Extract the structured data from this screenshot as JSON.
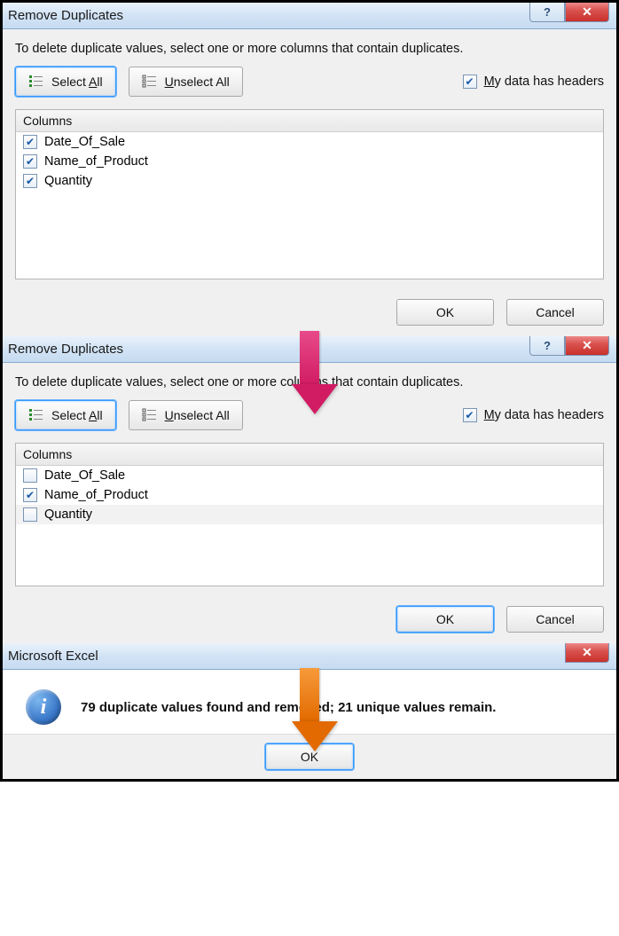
{
  "dialog1": {
    "title": "Remove Duplicates",
    "help_tip": "?",
    "close_tip": "✕",
    "instruction": "To delete duplicate values, select one or more columns that contain duplicates.",
    "select_all": {
      "prefix": "Select ",
      "hot": "A",
      "suffix": "ll"
    },
    "unselect_all": {
      "prefix": "",
      "hot": "U",
      "suffix": "nselect All"
    },
    "headers_chk": {
      "checked": true,
      "prefix": "",
      "hot": "M",
      "suffix": "y data has headers"
    },
    "columns_header": "Columns",
    "columns": [
      {
        "label": "Date_Of_Sale",
        "checked": true
      },
      {
        "label": "Name_of_Product",
        "checked": true
      },
      {
        "label": "Quantity",
        "checked": true
      }
    ],
    "ok": "OK",
    "cancel": "Cancel"
  },
  "dialog2": {
    "title": "Remove Duplicates",
    "help_tip": "?",
    "close_tip": "✕",
    "instruction": "To delete duplicate values, select one or more columns that contain duplicates.",
    "select_all": {
      "prefix": "Select ",
      "hot": "A",
      "suffix": "ll"
    },
    "unselect_all": {
      "prefix": "",
      "hot": "U",
      "suffix": "nselect All"
    },
    "headers_chk": {
      "checked": true,
      "prefix": "",
      "hot": "M",
      "suffix": "y data has headers"
    },
    "columns_header": "Columns",
    "columns": [
      {
        "label": "Date_Of_Sale",
        "checked": false
      },
      {
        "label": "Name_of_Product",
        "checked": true
      },
      {
        "label": "Quantity",
        "checked": false,
        "shaded": true
      }
    ],
    "ok": "OK",
    "cancel": "Cancel"
  },
  "msgbox": {
    "title": "Microsoft Excel",
    "close_tip": "✕",
    "text": "79 duplicate values found and removed; 21 unique values remain.",
    "ok": "OK"
  },
  "arrows": {
    "color1": {
      "c1": "#e84a8a",
      "c2": "#d11c63"
    },
    "color2": {
      "c1": "#f79a3a",
      "c2": "#e26a00"
    }
  }
}
